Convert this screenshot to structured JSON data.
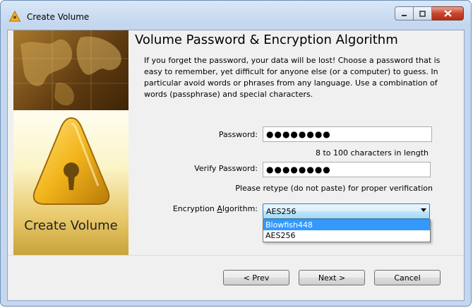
{
  "window": {
    "title": "Create Volume"
  },
  "banner": {
    "text": "Create Volume"
  },
  "page": {
    "title": "Volume Password & Encryption Algorithm",
    "description": "If you forget the password, your data will be lost! Choose a password that is easy to remember, yet difficult for anyone else (or a computer) to guess. In particular avoid words or phrases from any language. Use a combination of words (passphrase) and special characters."
  },
  "password": {
    "label": "Password:",
    "value": "●●●●●●●●",
    "hint": "8 to 100 characters in length"
  },
  "verify": {
    "label": "Verify Password:",
    "value": "●●●●●●●●",
    "hint": "Please retype (do not paste) for proper verification"
  },
  "algorithm": {
    "label_pre": "Encryption ",
    "label_accel": "A",
    "label_post": "lgorithm:",
    "selected": "AES256",
    "options": [
      "Blowfish448",
      "AES256"
    ],
    "highlighted_option": "Blowfish448"
  },
  "buttons": {
    "prev": "< Prev",
    "next": "Next >",
    "cancel": "Cancel"
  },
  "icons": {
    "app": "warning-triangle-icon",
    "banner": "keyhole-triangle-icon"
  },
  "colors": {
    "selection": "#3399ff",
    "accent": "#e0a020"
  }
}
